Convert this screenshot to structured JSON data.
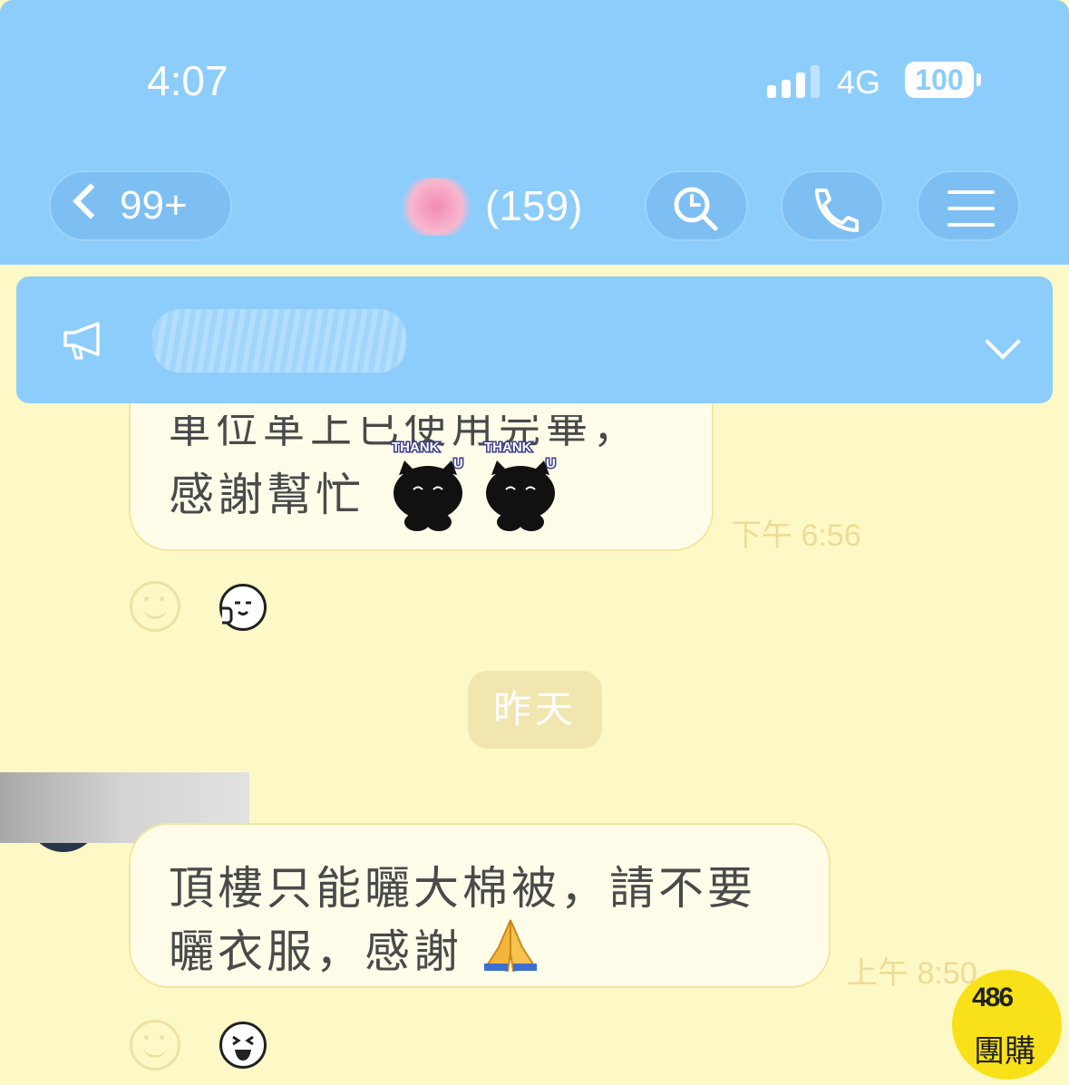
{
  "status_bar": {
    "time": "4:07",
    "network": "4G",
    "battery": "100"
  },
  "header": {
    "back_count": "99+",
    "member_count": "(159)"
  },
  "messages": [
    {
      "line1_partial": "車位革上已使用完畢，",
      "line2": "感謝幫忙",
      "sticker_text": "THANK U",
      "time": "下午 6:56"
    },
    {
      "line1": "頂樓只能曬大棉被，請不要",
      "line2": "曬衣服，感謝",
      "time": "上午 8:50"
    }
  ],
  "date_divider": "昨天",
  "badge": {
    "number": "486",
    "label": "團購"
  },
  "colors": {
    "header": "#8dcdfb",
    "chat_bg": "#fdf9c6",
    "bubble": "#fffdea",
    "badge": "#f9e11a"
  }
}
